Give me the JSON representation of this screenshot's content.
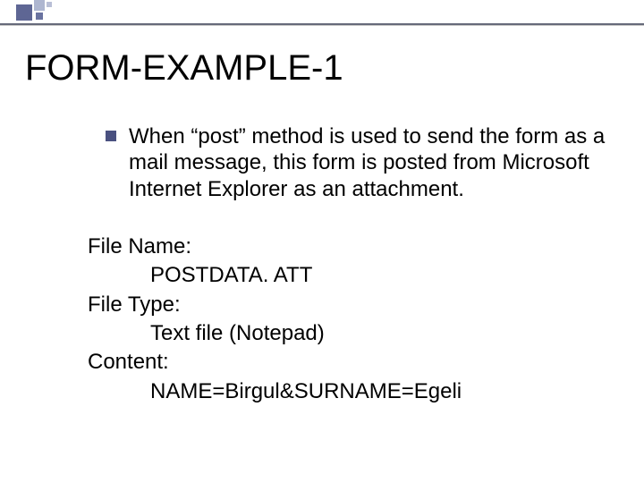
{
  "title": "FORM-EXAMPLE-1",
  "bullet": {
    "text": "When “post” method is used to send the form as a mail message, this form is posted from Microsoft Internet Explorer as an attachment."
  },
  "defs": {
    "file_name_label": "File Name:",
    "file_name_value": "POSTDATA. ATT",
    "file_type_label": "File Type:",
    "file_type_value": "Text file (Notepad)",
    "content_label": "Content:",
    "content_value": "NAME=Birgul&SURNAME=Egeli"
  }
}
